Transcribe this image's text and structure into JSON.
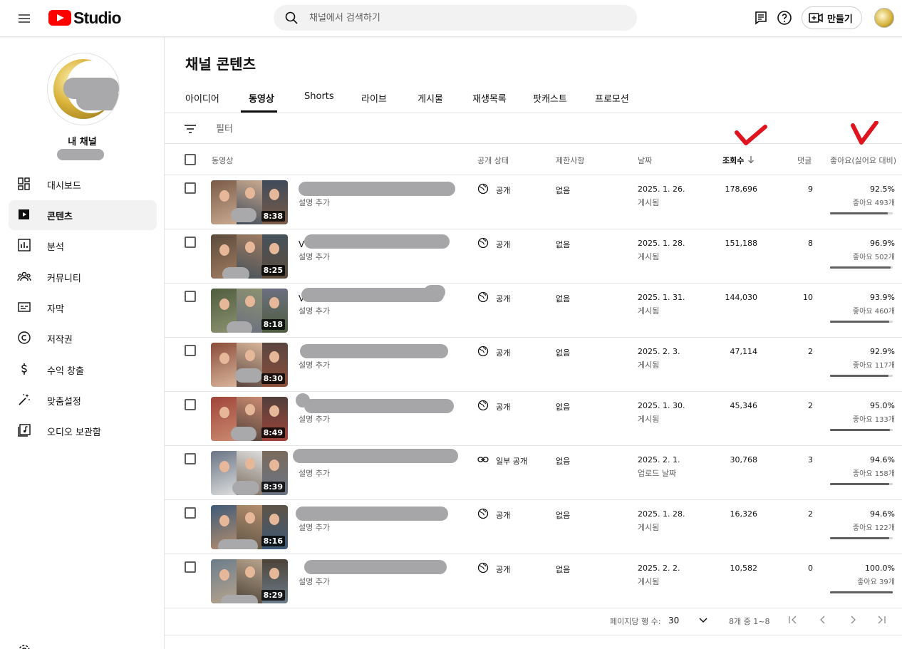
{
  "app": {
    "logo_text": "Studio"
  },
  "header": {
    "search_placeholder": "채널에서 검색하기",
    "create_label": "만들기"
  },
  "sidebar": {
    "channel_label": "내 채널",
    "items": [
      {
        "label": "대시보드",
        "icon": "dashboard-icon",
        "active": false
      },
      {
        "label": "콘텐츠",
        "icon": "content-icon",
        "active": true
      },
      {
        "label": "분석",
        "icon": "analytics-icon",
        "active": false
      },
      {
        "label": "커뮤니티",
        "icon": "community-icon",
        "active": false
      },
      {
        "label": "자막",
        "icon": "subtitles-icon",
        "active": false
      },
      {
        "label": "저작권",
        "icon": "copyright-icon",
        "active": false
      },
      {
        "label": "수익 창출",
        "icon": "monetization-icon",
        "active": false
      },
      {
        "label": "맞춤설정",
        "icon": "customization-icon",
        "active": false
      },
      {
        "label": "오디오 보관함",
        "icon": "audio-library-icon",
        "active": false
      }
    ]
  },
  "main": {
    "title": "채널 콘텐츠",
    "tabs": [
      {
        "label": "아이디어",
        "active": false
      },
      {
        "label": "동영상",
        "active": true
      },
      {
        "label": "Shorts",
        "active": false
      },
      {
        "label": "라이브",
        "active": false
      },
      {
        "label": "게시물",
        "active": false
      },
      {
        "label": "재생목록",
        "active": false
      },
      {
        "label": "팟캐스트",
        "active": false
      },
      {
        "label": "프로모션",
        "active": false
      }
    ],
    "filter_placeholder": "필터",
    "columns": {
      "video": "동영상",
      "visibility": "공개 상태",
      "restrictions": "제한사항",
      "date": "날짜",
      "views": "조회수",
      "comments": "댓글",
      "likes": "좋아요(싫어요 대비)"
    },
    "rows": [
      {
        "duration": "8:38",
        "description": "설명 추가",
        "visibility": "공개",
        "visibility_icon": "globe-icon",
        "restrictions": "없음",
        "date": "2025. 1. 26.",
        "status": "게시됨",
        "views": "178,696",
        "comments": "9",
        "like_pct": "92.5%",
        "likes": "좋아요 493개",
        "like_ratio": 0.925
      },
      {
        "title_prefix": "V",
        "duration": "8:25",
        "description": "설명 추가",
        "visibility": "공개",
        "visibility_icon": "globe-icon",
        "restrictions": "없음",
        "date": "2025. 1. 28.",
        "status": "게시됨",
        "views": "151,188",
        "comments": "8",
        "like_pct": "96.9%",
        "likes": "좋아요 502개",
        "like_ratio": 0.969
      },
      {
        "title_prefix": "V",
        "duration": "8:18",
        "description": "설명 추가",
        "visibility": "공개",
        "visibility_icon": "globe-icon",
        "restrictions": "없음",
        "date": "2025. 1. 31.",
        "status": "게시됨",
        "views": "144,030",
        "comments": "10",
        "like_pct": "93.9%",
        "likes": "좋아요 460개",
        "like_ratio": 0.939
      },
      {
        "duration": "8:30",
        "description": "설명 추가",
        "visibility": "공개",
        "visibility_icon": "globe-icon",
        "restrictions": "없음",
        "date": "2025. 2. 3.",
        "status": "게시됨",
        "views": "47,114",
        "comments": "2",
        "like_pct": "92.9%",
        "likes": "좋아요 117개",
        "like_ratio": 0.929
      },
      {
        "duration": "8:49",
        "description": "설명 추가",
        "visibility": "공개",
        "visibility_icon": "globe-icon",
        "restrictions": "없음",
        "date": "2025. 1. 30.",
        "status": "게시됨",
        "views": "45,346",
        "comments": "2",
        "like_pct": "95.0%",
        "likes": "좋아요 133개",
        "like_ratio": 0.95
      },
      {
        "duration": "8:39",
        "description": "설명 추가",
        "visibility": "일부 공개",
        "visibility_icon": "link-icon",
        "restrictions": "없음",
        "date": "2025. 2. 1.",
        "status": "업로드 날짜",
        "views": "30,768",
        "comments": "3",
        "like_pct": "94.6%",
        "likes": "좋아요 158개",
        "like_ratio": 0.946
      },
      {
        "duration": "8:16",
        "description": "설명 추가",
        "visibility": "공개",
        "visibility_icon": "globe-icon",
        "restrictions": "없음",
        "date": "2025. 1. 28.",
        "status": "게시됨",
        "views": "16,326",
        "comments": "2",
        "like_pct": "94.6%",
        "likes": "좋아요 122개",
        "like_ratio": 0.946
      },
      {
        "duration": "8:29",
        "description": "설명 추가",
        "visibility": "공개",
        "visibility_icon": "globe-icon",
        "restrictions": "없음",
        "date": "2025. 2. 2.",
        "status": "게시됨",
        "views": "10,582",
        "comments": "0",
        "like_pct": "100.0%",
        "likes": "좋아요 39개",
        "like_ratio": 1.0
      }
    ],
    "pagination": {
      "rows_per_page_label": "페이지당 행 수:",
      "rows_per_page": "30",
      "range": "8개 중 1~8"
    }
  },
  "colors": {
    "brand_red": "#ff0000",
    "annotation_red": "#e0141e",
    "text_primary": "#0f0f0f",
    "text_secondary": "#606060",
    "active_nav_bg": "#f2f2f2"
  }
}
